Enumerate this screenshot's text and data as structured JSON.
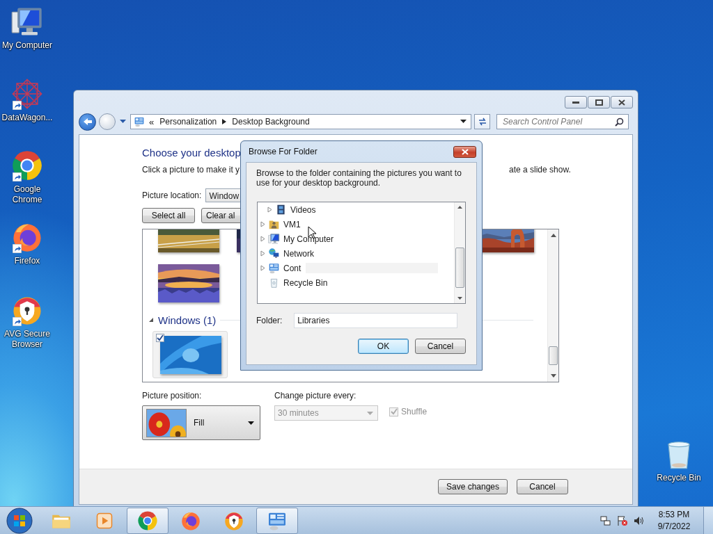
{
  "desktop_icons": [
    {
      "label": "My Computer",
      "kind": "computer",
      "shortcut": false
    },
    {
      "label": "DataWagon...",
      "kind": "mesh",
      "shortcut": true
    },
    {
      "label": "Google Chrome",
      "kind": "chrome",
      "shortcut": true
    },
    {
      "label": "Firefox",
      "kind": "firefox",
      "shortcut": true
    },
    {
      "label": "AVG Secure Browser",
      "kind": "avg",
      "shortcut": true
    },
    {
      "label": "Recycle Bin",
      "kind": "trash",
      "shortcut": false
    }
  ],
  "window": {
    "address": {
      "overflow_marker": "«",
      "crumbs": [
        "Personalization",
        "Desktop Background"
      ]
    },
    "search": {
      "placeholder": "Search Control Panel"
    },
    "heading": "Choose your desktop",
    "description_left": "Click a picture to make it y",
    "description_right": "ate a slide show.",
    "picture_location": {
      "label": "Picture location:",
      "value": "Window"
    },
    "select_buttons": [
      "Select all",
      "Clear al"
    ],
    "group": {
      "label": "Windows (1)",
      "expanded": true,
      "items": [
        {
          "kind": "picture",
          "checked": true
        }
      ]
    },
    "picture_position": {
      "label": "Picture position:",
      "value": "Fill"
    },
    "change_picture": {
      "label": "Change picture every:",
      "value": "30 minutes",
      "disabled": true
    },
    "shuffle": {
      "label": "Shuffle",
      "checked": true,
      "disabled": true
    },
    "buttons": [
      "Save changes",
      "Cancel"
    ]
  },
  "dialog": {
    "title": "Browse For Folder",
    "instruction": "Browse to the folder containing the pictures you want to use for your desktop background.",
    "tree": [
      {
        "children": [
          {
            "label": "Videos",
            "kind": "film",
            "expandable": true
          }
        ]
      },
      {
        "label": "VM1",
        "kind": "user-folder",
        "expandable": true
      },
      {
        "label": "My Computer",
        "kind": "computer",
        "expandable": true
      },
      {
        "label": "Network",
        "kind": "network",
        "expandable": true
      },
      {
        "label": "Cont",
        "kind": "control-panel",
        "expandable": true
      },
      {
        "label": "Recycle Bin",
        "kind": "recycle",
        "expandable": false
      }
    ],
    "folder": {
      "label": "Folder:",
      "value": "Libraries"
    },
    "buttons": [
      {
        "label": "OK",
        "default": true
      },
      {
        "label": "Cancel",
        "default": false
      }
    ]
  },
  "taskbar": {
    "items": [
      {
        "kind": "folder",
        "open": false
      },
      {
        "kind": "media",
        "open": false
      },
      {
        "kind": "chrome",
        "open": true
      },
      {
        "kind": "firefox",
        "open": false
      },
      {
        "kind": "avg",
        "open": false
      },
      {
        "kind": "control-panel",
        "open": true
      }
    ],
    "clock": {
      "time": "8:53 PM",
      "date": "9/7/2022"
    }
  }
}
